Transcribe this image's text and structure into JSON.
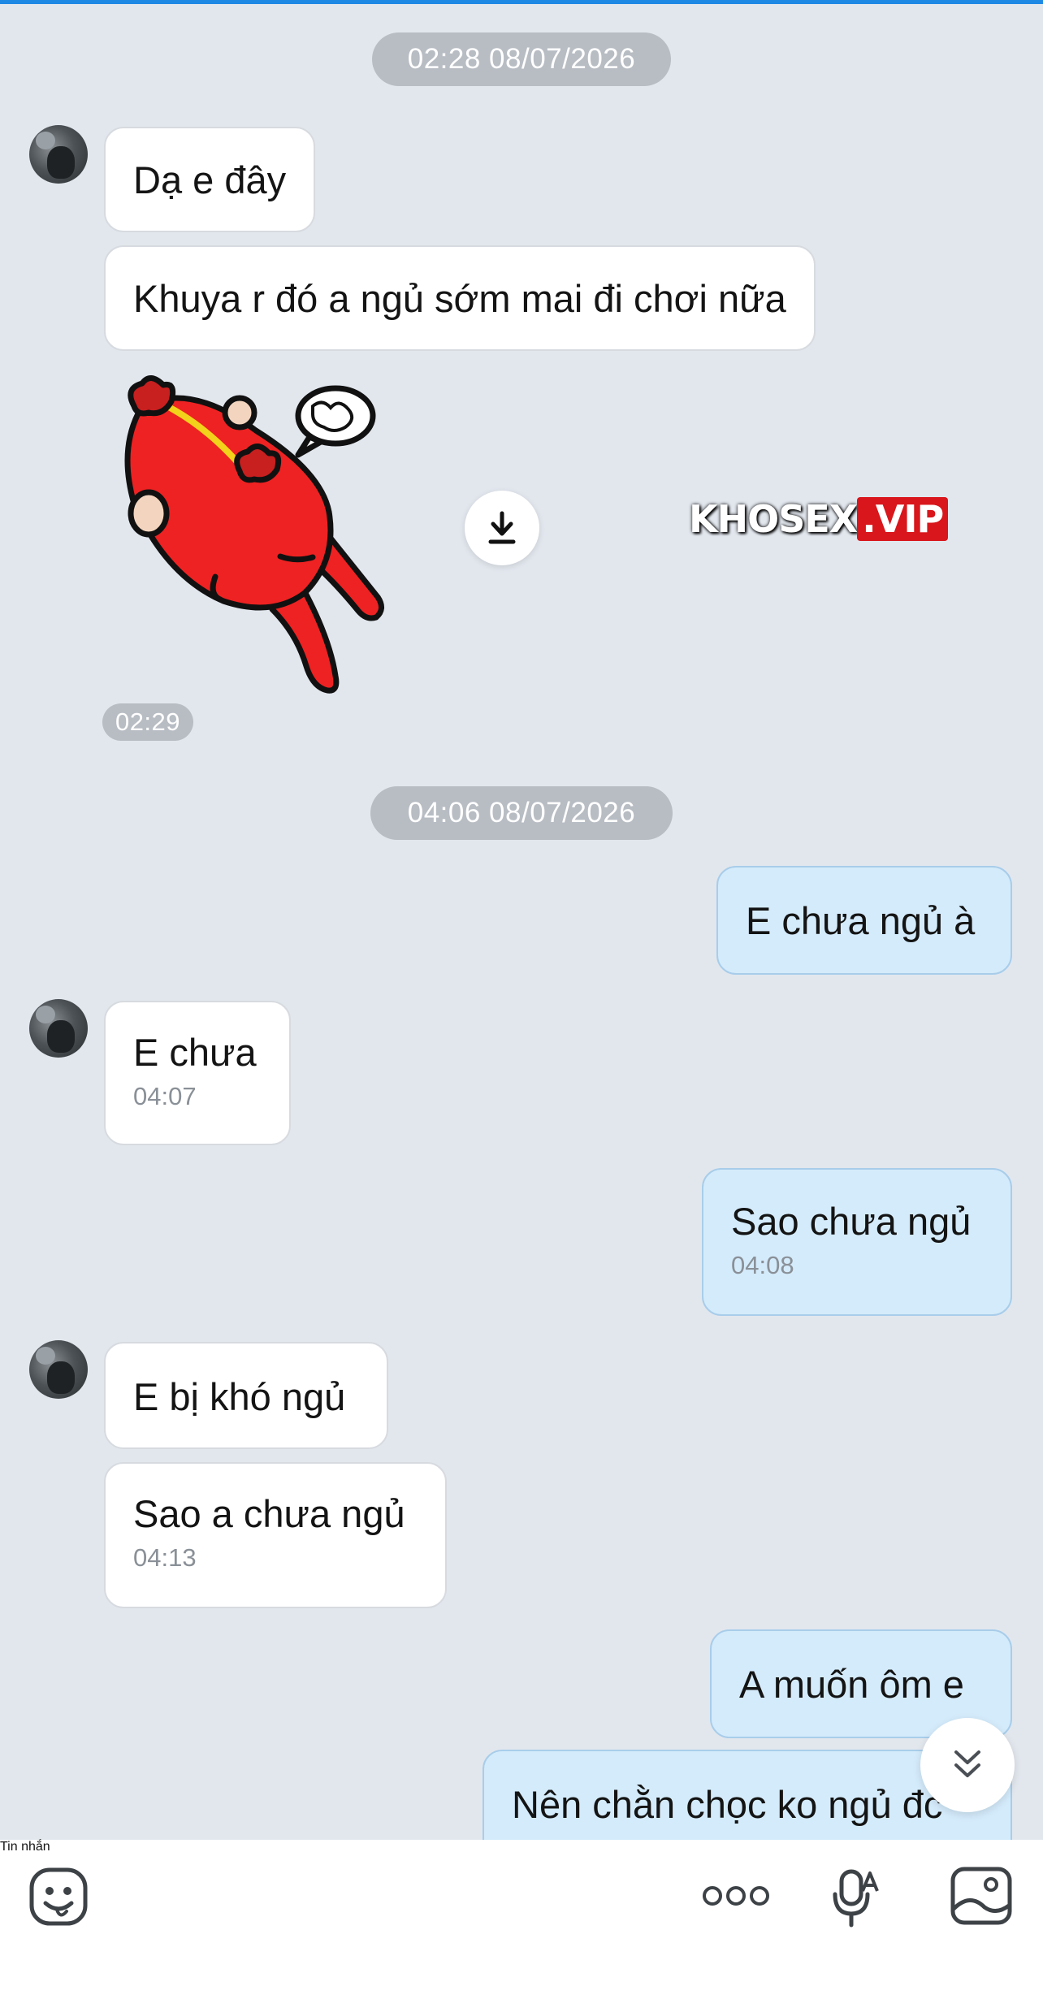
{
  "conversation": {
    "sections": [
      {
        "date_label": "02:28 08/07/2026"
      },
      {
        "date_label": "04:06 08/07/2026"
      }
    ],
    "messages": [
      {
        "sender": "contact",
        "text": "Dạ e đây"
      },
      {
        "sender": "contact",
        "text": "Khuya r đó a ngủ sớm mai đi chơi nữa"
      },
      {
        "sender": "contact",
        "type": "sticker",
        "time": "02:29"
      },
      {
        "sender": "me",
        "text": "E chưa ngủ à"
      },
      {
        "sender": "contact",
        "text": "E chưa",
        "time": "04:07"
      },
      {
        "sender": "me",
        "text": "Sao chưa ngủ",
        "time": "04:08"
      },
      {
        "sender": "contact",
        "text": "E bị khó ngủ"
      },
      {
        "sender": "contact",
        "text": "Sao a chưa ngủ",
        "time": "04:13"
      },
      {
        "sender": "me",
        "text": "A muốn ôm e"
      },
      {
        "sender": "me",
        "text": "Nên chằn chọc ko ngủ đc"
      }
    ]
  },
  "watermark": {
    "part1": "KHOSEX",
    "part2": ".VIP"
  },
  "composer": {
    "placeholder": "Tin nhắn",
    "icons": [
      "sticker-smiley-icon",
      "more-dots-icon",
      "voice-to-text-mic-icon",
      "photo-gallery-icon"
    ]
  },
  "icons": {
    "download": "download-icon",
    "scroll_down": "double-chevron-down-icon"
  },
  "colors": {
    "background": "#e2e7ee",
    "incoming_bubble": "#ffffff",
    "outgoing_bubble": "#d4ebfb",
    "outgoing_border": "#a8cdea",
    "pill": "#b8bdc4",
    "accent": "#1e88e5",
    "sticker_red": "#ee2222"
  }
}
